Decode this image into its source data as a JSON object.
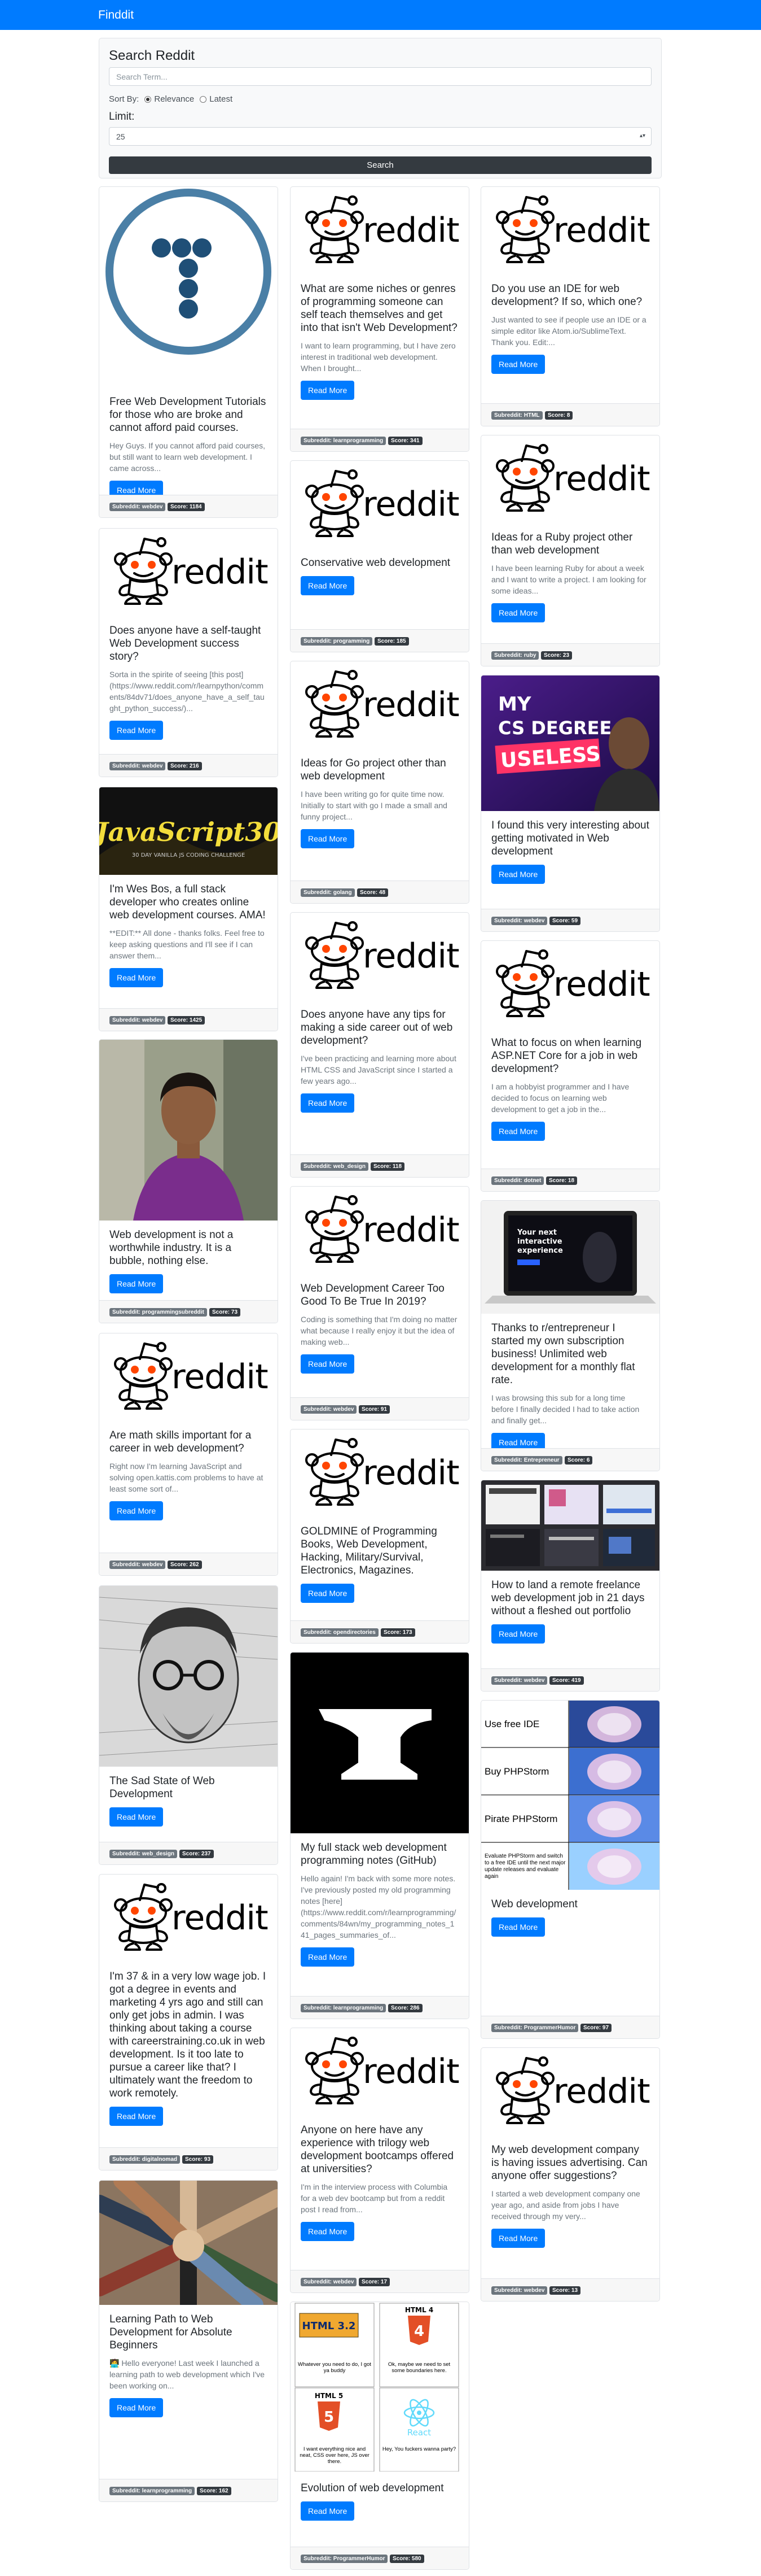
{
  "app": {
    "brand": "Finddit"
  },
  "search": {
    "title": "Search Reddit",
    "placeholder": "Search Term...",
    "sort_label": "Sort By:",
    "sort_options": [
      "Relevance",
      "Latest"
    ],
    "limit_label": "Limit:",
    "limit_value": "25",
    "button": "Search"
  },
  "read_more": "Read More",
  "cards": [
    {
      "title": "Free Web Development Tutorials for those who are broke and cannot afford paid courses.",
      "text": "Hey Guys. If you cannot afford paid courses, but still want to learn web development. I came across...",
      "subreddit": "Subreddit: webdev",
      "score": "Score: 1184",
      "image": "tutorial-logo"
    },
    {
      "title": "Does anyone have a self-taught Web Development success story?",
      "text": "Sorta in the spirite of seeing [this post](https://www.reddit.com/r/learnpython/comments/84dv71/does_anyone_have_a_self_taught_python_success/)...",
      "subreddit": "Subreddit: webdev",
      "score": "Score: 216",
      "image": "reddit-alien"
    },
    {
      "title": "I'm Wes Bos, a full stack developer who creates online web development courses. AMA!",
      "text": "**EDIT:** All done - thanks folks. Feel free to keep asking questions and I'll see if I can answer them...",
      "subreddit": "Subreddit: webdev",
      "score": "Score: 1425",
      "image": "javascript30"
    },
    {
      "title": "Web development is not a worthwhile industry. It is a bubble, nothing else.",
      "text": "",
      "subreddit": "Subreddit: programmingsubreddit",
      "score": "Score: 73",
      "image": "person-photo"
    },
    {
      "title": "Are math skills important for a career in web development?",
      "text": "Right now I'm learning JavaScript and solving open.kattis.com problems to have at least some sort of...",
      "subreddit": "Subreddit: webdev",
      "score": "Score: 262",
      "image": "reddit-alien"
    },
    {
      "title": "The Sad State of Web Development",
      "text": "",
      "subreddit": "Subreddit: web_design",
      "score": "Score: 237",
      "image": "sketch-portrait"
    },
    {
      "title": "I'm 37 & in a very low wage job. I got a degree in events and marketing 4 yrs ago and still can only get jobs in admin. I was thinking about taking a course with careerstraining.co.uk in web development. Is it too late to pursue a career like that? I ultimately want the freedom to work remotely.",
      "text": "",
      "subreddit": "Subreddit: digitalnomad",
      "score": "Score: 93",
      "image": "reddit-alien"
    },
    {
      "title": "Learning Path to Web Development for Absolute Beginners",
      "text": "🧑‍💻 Hello everyone! Last week I launched a learning path to web development which I've been working on...",
      "subreddit": "Subreddit: learnprogramming",
      "score": "Score: 162",
      "image": "team-hands"
    },
    {
      "title": "What are some niches or genres of programming someone can self teach themselves and get into that isn't Web Development?",
      "text": "I want to learn programming, but I have zero interest in traditional web development. When I brought...",
      "subreddit": "Subreddit: learnprogramming",
      "score": "Score: 341",
      "image": "reddit-alien"
    },
    {
      "title": "Conservative web development",
      "text": "",
      "subreddit": "Subreddit: programming",
      "score": "Score: 185",
      "image": "reddit-alien"
    },
    {
      "title": "Ideas for Go project other than web development",
      "text": "I have been writing go for quite time now. Initially to start with go I made a small and funny project...",
      "subreddit": "Subreddit: golang",
      "score": "Score: 48",
      "image": "reddit-alien"
    },
    {
      "title": "Does anyone have any tips for making a side career out of web development?",
      "text": "I've been practicing and learning more about HTML CSS and JavaScript since I started a few years ago...",
      "subreddit": "Subreddit: web_design",
      "score": "Score: 118",
      "image": "reddit-alien"
    },
    {
      "title": "Web Development Career Too Good To Be True In 2019?",
      "text": "Coding is something that I'm doing no matter what because I really enjoy it but the idea of making web...",
      "subreddit": "Subreddit: webdev",
      "score": "Score: 91",
      "image": "reddit-alien"
    },
    {
      "title": "GOLDMINE of Programming Books, Web Development, Hacking, Military/Survival, Electronics, Magazines.",
      "text": "",
      "subreddit": "Subreddit: opendirectories",
      "score": "Score: 173",
      "image": "reddit-alien"
    },
    {
      "title": "My full stack web development programming notes (GitHub)",
      "text": "Hello again! I'm back with some more notes. I've previously posted my old programming notes [here](https://www.reddit.com/r/learnprogramming/comments/84wn/my_programming_notes_141_pages_summaries_of...",
      "subreddit": "Subreddit: learnprogramming",
      "score": "Score: 286",
      "image": "anvil"
    },
    {
      "title": "Anyone on here have any experience with trilogy web development bootcamps offered at universities?",
      "text": "I'm in the interview process with Columbia for a web dev bootcamp but from a reddit post I read from...",
      "subreddit": "Subreddit: webdev",
      "score": "Score: 17",
      "image": "reddit-alien"
    },
    {
      "title": "Evolution of web development",
      "text": "",
      "subreddit": "Subreddit: ProgrammerHumor",
      "score": "Score: 580",
      "image": "evolution-meme"
    },
    {
      "title": "Do you use an IDE for web development? If so, which one?",
      "text": "Just wanted to see if people use an IDE or a simple editor like Atom.io/SublimeText. Thank you. Edit:...",
      "subreddit": "Subreddit: HTML",
      "score": "Score: 8",
      "image": "reddit-alien"
    },
    {
      "title": "Ideas for a Ruby project other than web development",
      "text": "I have been learning Ruby for about a week and I want to write a project. I am looking for some ideas...",
      "subreddit": "Subreddit: ruby",
      "score": "Score: 23",
      "image": "reddit-alien"
    },
    {
      "title": "I found this very interesting about getting motivated in Web development",
      "text": "",
      "subreddit": "Subreddit: webdev",
      "score": "Score: 59",
      "image": "cs-degree-thumb"
    },
    {
      "title": "What to focus on when learning ASP.NET Core for a job in web development?",
      "text": "I am a hobbyist programmer and I have decided to focus on learning web development to get a job in the...",
      "subreddit": "Subreddit: dotnet",
      "score": "Score: 18",
      "image": "reddit-alien"
    },
    {
      "title": "Thanks to r/entrepreneur I started my own subscription business! Unlimited web development for a monthly flat rate.",
      "text": "I was browsing this sub for a long time before I finally decided I had to take action and finally get...",
      "subreddit": "Subreddit: Entrepreneur",
      "score": "Score: 6",
      "image": "laptop-mockup"
    },
    {
      "title": "How to land a remote freelance web development job in 21 days without a fleshed out portfolio",
      "text": "",
      "subreddit": "Subreddit: webdev",
      "score": "Score: 419",
      "image": "screens-collage"
    },
    {
      "title": "Web development",
      "text": "",
      "subreddit": "Subreddit: ProgrammerHumor",
      "score": "Score: 97",
      "image": "brain-meme"
    },
    {
      "title": "My web development company is having issues advertising. Can anyone offer suggestions?",
      "text": "I started a web development company one year ago, and aside from jobs I have received through my very...",
      "subreddit": "Subreddit: webdev",
      "score": "Score: 13",
      "image": "reddit-alien"
    }
  ],
  "image_text": {
    "js30": {
      "title": "JavaScript30",
      "subtitle": "30 DAY VANILLA JS CODING CHALLENGE"
    },
    "cs_degree": {
      "line1": "MY",
      "line2": "CS DEGREE IS",
      "line3": "USELESS"
    },
    "laptop": {
      "line1": "Your next",
      "line2": "interactive",
      "line3": "experience"
    },
    "brain": [
      "Use free IDE",
      "Buy PHPStorm",
      "Pirate PHPStorm",
      "Evaluate PHPStorm and switch to a free IDE until the next major update releases and evaluate again"
    ],
    "evolution": {
      "html32": "HTML 3.2",
      "html32_caption": "Whatever you need to do, I got ya buddy",
      "html4": "HTML 4",
      "html4_caption": "Ok, maybe we need to set some boundaries here.",
      "html5": "HTML 5",
      "html5_caption": "I want everything nice and neat, CSS over here, JS over there.",
      "react": "React",
      "react_caption": "Hey, You fuckers wanna party?"
    }
  },
  "colors": {
    "navbar": "#007bff",
    "primary": "#007bff",
    "dark": "#343a40",
    "secondary": "#6c757d"
  }
}
